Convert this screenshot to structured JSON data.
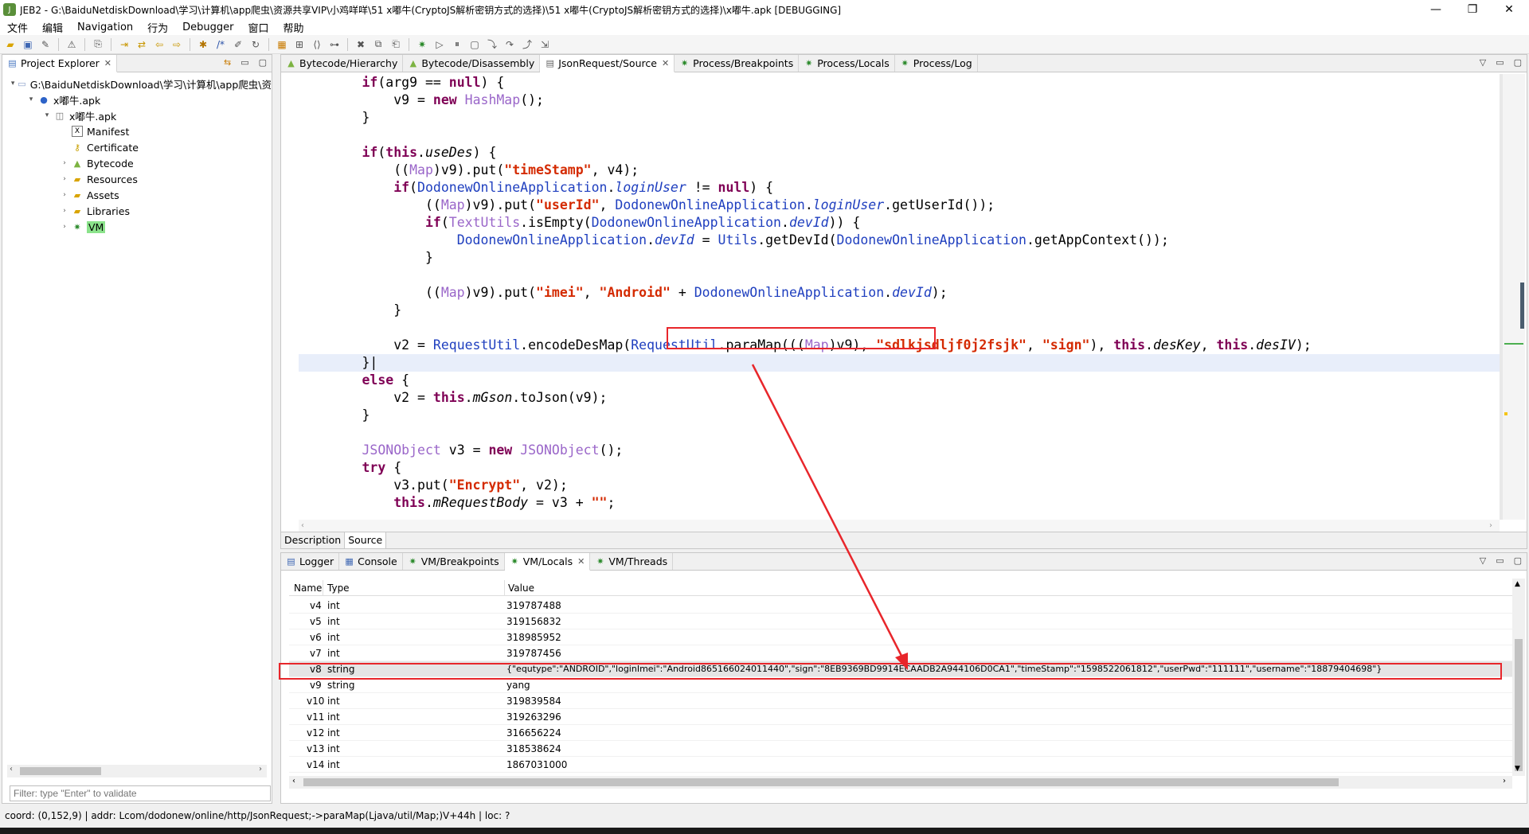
{
  "window": {
    "title": "JEB2 - G:\\BaiduNetdiskDownload\\学习\\计算机\\app爬虫\\资源共享VIP\\小鸡咩咩\\51 x嘟牛(CryptoJS解析密钥方式的选择)\\51 x嘟牛(CryptoJS解析密钥方式的选择)\\x嘟牛.apk [DEBUGGING]",
    "minimize": "—",
    "maximize": "❐",
    "close": "✕"
  },
  "menu": [
    "文件",
    "编辑",
    "Navigation",
    "行为",
    "Debugger",
    "窗口",
    "帮助"
  ],
  "project_explorer": {
    "tab": "Project Explorer",
    "tree": [
      {
        "label": "G:\\BaiduNetdiskDownload\\学习\\计算机\\app爬虫\\资",
        "twist": "▾",
        "icon": "folder-icon"
      },
      {
        "label": "x嘟牛.apk",
        "twist": "▾",
        "icon": "artifact-icon"
      },
      {
        "label": "x嘟牛.apk",
        "twist": "▾",
        "icon": "apk-icon"
      },
      {
        "label": "Manifest",
        "twist": "",
        "icon": "manifest-icon"
      },
      {
        "label": "Certificate",
        "twist": "",
        "icon": "certificate-icon"
      },
      {
        "label": "Bytecode",
        "twist": "›",
        "icon": "android-icon"
      },
      {
        "label": "Resources",
        "twist": "›",
        "icon": "folder-icon"
      },
      {
        "label": "Assets",
        "twist": "›",
        "icon": "folder-icon"
      },
      {
        "label": "Libraries",
        "twist": "›",
        "icon": "folder-icon"
      },
      {
        "label": "VM",
        "twist": "›",
        "icon": "gear-icon"
      }
    ],
    "filter_placeholder": "Filter: type \"Enter\" to validate"
  },
  "editor": {
    "tabs": [
      "Bytecode/Hierarchy",
      "Bytecode/Disassembly",
      "JsonRequest/Source",
      "Process/Breakpoints",
      "Process/Locals",
      "Process/Log"
    ],
    "bottom_tabs": [
      "Description",
      "Source"
    ]
  },
  "bottom": {
    "tabs": [
      "Logger",
      "Console",
      "VM/Breakpoints",
      "VM/Locals",
      "VM/Threads"
    ],
    "columns": [
      "Name",
      "Type",
      "Value"
    ],
    "rows": [
      {
        "name": "v4",
        "type": "int",
        "value": "319787488"
      },
      {
        "name": "v5",
        "type": "int",
        "value": "319156832"
      },
      {
        "name": "v6",
        "type": "int",
        "value": "318985952"
      },
      {
        "name": "v7",
        "type": "int",
        "value": "319787456"
      },
      {
        "name": "v8",
        "type": "string",
        "value": "{\"equtype\":\"ANDROID\",\"loginImei\":\"Android865166024011440\",\"sign\":\"8EB9369BD9914ECAADB2A944106D0CA1\",\"timeStamp\":\"1598522061812\",\"userPwd\":\"111111\",\"username\":\"18879404698\"}"
      },
      {
        "name": "v9",
        "type": "string",
        "value": "yang"
      },
      {
        "name": "v10",
        "type": "int",
        "value": "319839584"
      },
      {
        "name": "v11",
        "type": "int",
        "value": "319263296"
      },
      {
        "name": "v12",
        "type": "int",
        "value": "316656224"
      },
      {
        "name": "v13",
        "type": "int",
        "value": "318538624"
      },
      {
        "name": "v14",
        "type": "int",
        "value": "1867031000"
      }
    ]
  },
  "status": "coord: (0,152,9) | addr: Lcom/dodonew/online/http/JsonRequest;->paraMap(Ljava/util/Map;)V+44h | loc: ?",
  "colors": {
    "highlight": "#e8262b",
    "keyword": "#7f0055",
    "string": "#d42a00",
    "class": "#1f3fbf"
  }
}
